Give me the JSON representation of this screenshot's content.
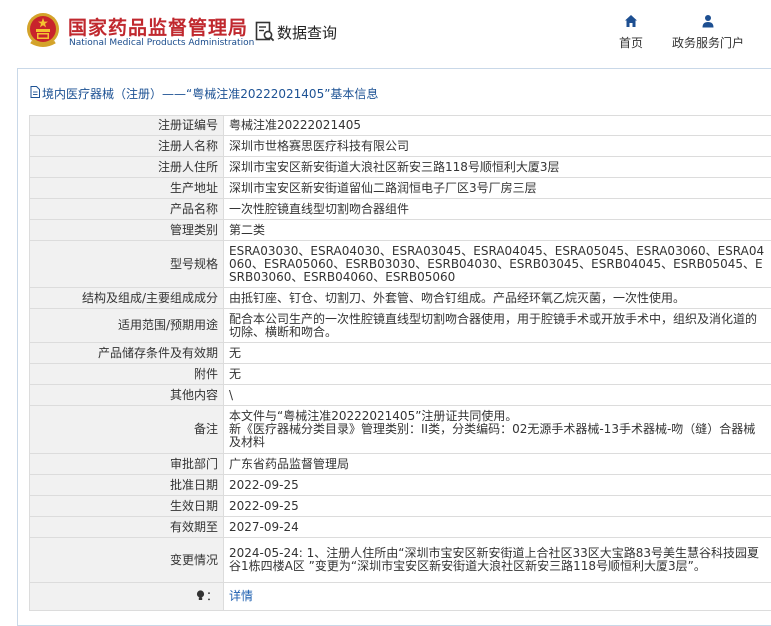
{
  "header": {
    "agency_name_cn": "国家药品监督管理局",
    "agency_name_en": "National Medical Products Administration",
    "data_query_label": "数据查询",
    "nav": [
      {
        "label": "首页",
        "icon": "home-icon"
      },
      {
        "label": "政务服务门户",
        "icon": "user-icon"
      }
    ],
    "brand_color": "#c0282e"
  },
  "panel": {
    "title": "境内医疗器械（注册）——“粤械注准20222021405”基本信息"
  },
  "record": {
    "rows": [
      {
        "label": "注册证编号",
        "value": "粤械注准20222021405"
      },
      {
        "label": "注册人名称",
        "value": "深圳市世格赛思医疗科技有限公司"
      },
      {
        "label": "注册人住所",
        "value": "深圳市宝安区新安街道大浪社区新安三路118号顺恒利大厦3层"
      },
      {
        "label": "生产地址",
        "value": "深圳市宝安区新安街道留仙二路润恒电子厂区3号厂房三层"
      },
      {
        "label": "产品名称",
        "value": "一次性腔镜直线型切割吻合器组件"
      },
      {
        "label": "管理类别",
        "value": "第二类"
      },
      {
        "label": "型号规格",
        "value": "ESRA03030、ESRA04030、ESRA03045、ESRA04045、ESRA05045、ESRA03060、ESRA04060、ESRA05060、ESRB03030、ESRB04030、ESRB03045、ESRB04045、ESRB05045、ESRB03060、ESRB04060、ESRB05060"
      },
      {
        "label": "结构及组成/主要组成成分",
        "value": "由抵钉座、钉仓、切割刀、外套管、吻合钉组成。产品经环氧乙烷灭菌，一次性使用。"
      },
      {
        "label": "适用范围/预期用途",
        "value": "配合本公司生产的一次性腔镜直线型切割吻合器使用，用于腔镜手术或开放手术中，组织及消化道的切除、横断和吻合。"
      },
      {
        "label": "产品储存条件及有效期",
        "value": "无"
      },
      {
        "label": "附件",
        "value": "无"
      },
      {
        "label": "其他内容",
        "value": "\\"
      },
      {
        "label": "备注",
        "value": "本文件与“粤械注准20222021405”注册证共同使用。\n新《医疗器械分类目录》管理类别：II类，分类编码：02无源手术器械-13手术器械-吻（缝）合器械及材料"
      },
      {
        "label": "审批部门",
        "value": "广东省药品监督管理局"
      },
      {
        "label": "批准日期",
        "value": "2022-09-25"
      },
      {
        "label": "生效日期",
        "value": "2022-09-25"
      },
      {
        "label": "有效期至",
        "value": "2027-09-24"
      },
      {
        "label": "变更情况",
        "value": "2024-05-24: 1、注册人住所由“深圳市宝安区新安街道上合社区33区大宝路83号美生慧谷科技园夏谷1栋四楼A区 ”变更为“深圳市宝安区新安街道大浪社区新安三路118号顺恒利大厦3层”。"
      }
    ],
    "detail_link": "详情",
    "detail_icon": "bulb-icon"
  }
}
